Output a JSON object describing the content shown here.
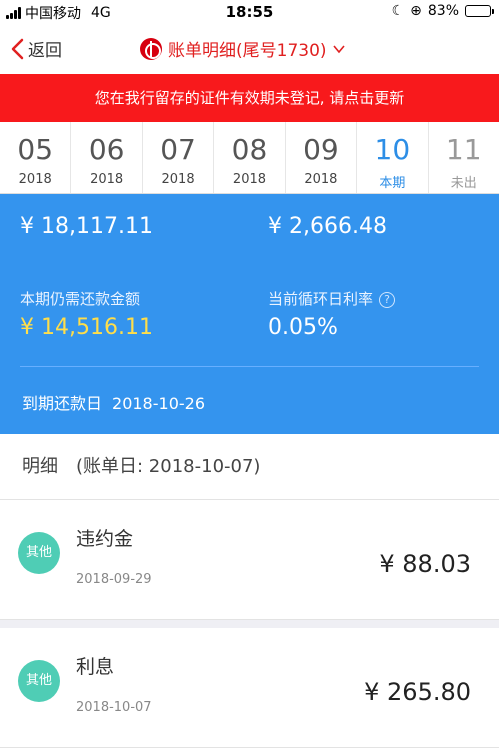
{
  "status": {
    "carrier": "中国移动",
    "network": "4G",
    "time": "18:55",
    "battery": "83%",
    "battery_level": 0.83
  },
  "nav": {
    "back_label": "返回",
    "title": "账单明细(尾号1730)"
  },
  "notice": "您在我行留存的证件有效期未登记, 请点击更新",
  "months": [
    {
      "month": "05",
      "sub": "2018"
    },
    {
      "month": "06",
      "sub": "2018"
    },
    {
      "month": "07",
      "sub": "2018"
    },
    {
      "month": "08",
      "sub": "2018"
    },
    {
      "month": "09",
      "sub": "2018"
    },
    {
      "month": "10",
      "sub": "本期"
    },
    {
      "month": "11",
      "sub": "未出"
    }
  ],
  "summary": {
    "total_amount": "¥ 18,117.11",
    "min_amount": "¥ 2,666.48",
    "remaining_label": "本期仍需还款金额",
    "remaining_value": "¥ 14,516.11",
    "rate_label": "当前循环日利率",
    "rate_value": "0.05%",
    "due_label": "到期还款日",
    "due_date": "2018-10-26"
  },
  "detail": {
    "label": "明细",
    "date_text": "(账单日: 2018-10-07)"
  },
  "transactions": [
    {
      "badge": "其他",
      "title": "违约金",
      "date": "2018-09-29",
      "amount": "¥ 88.03"
    },
    {
      "badge": "其他",
      "title": "利息",
      "date": "2018-10-07",
      "amount": "¥ 265.80"
    }
  ],
  "colors": {
    "accent_red": "#f8191c",
    "active_blue": "#2d8ee6",
    "card_blue": "#3494ee",
    "badge_teal": "#4fcdb5",
    "highlight_yellow": "#ffde4a"
  }
}
